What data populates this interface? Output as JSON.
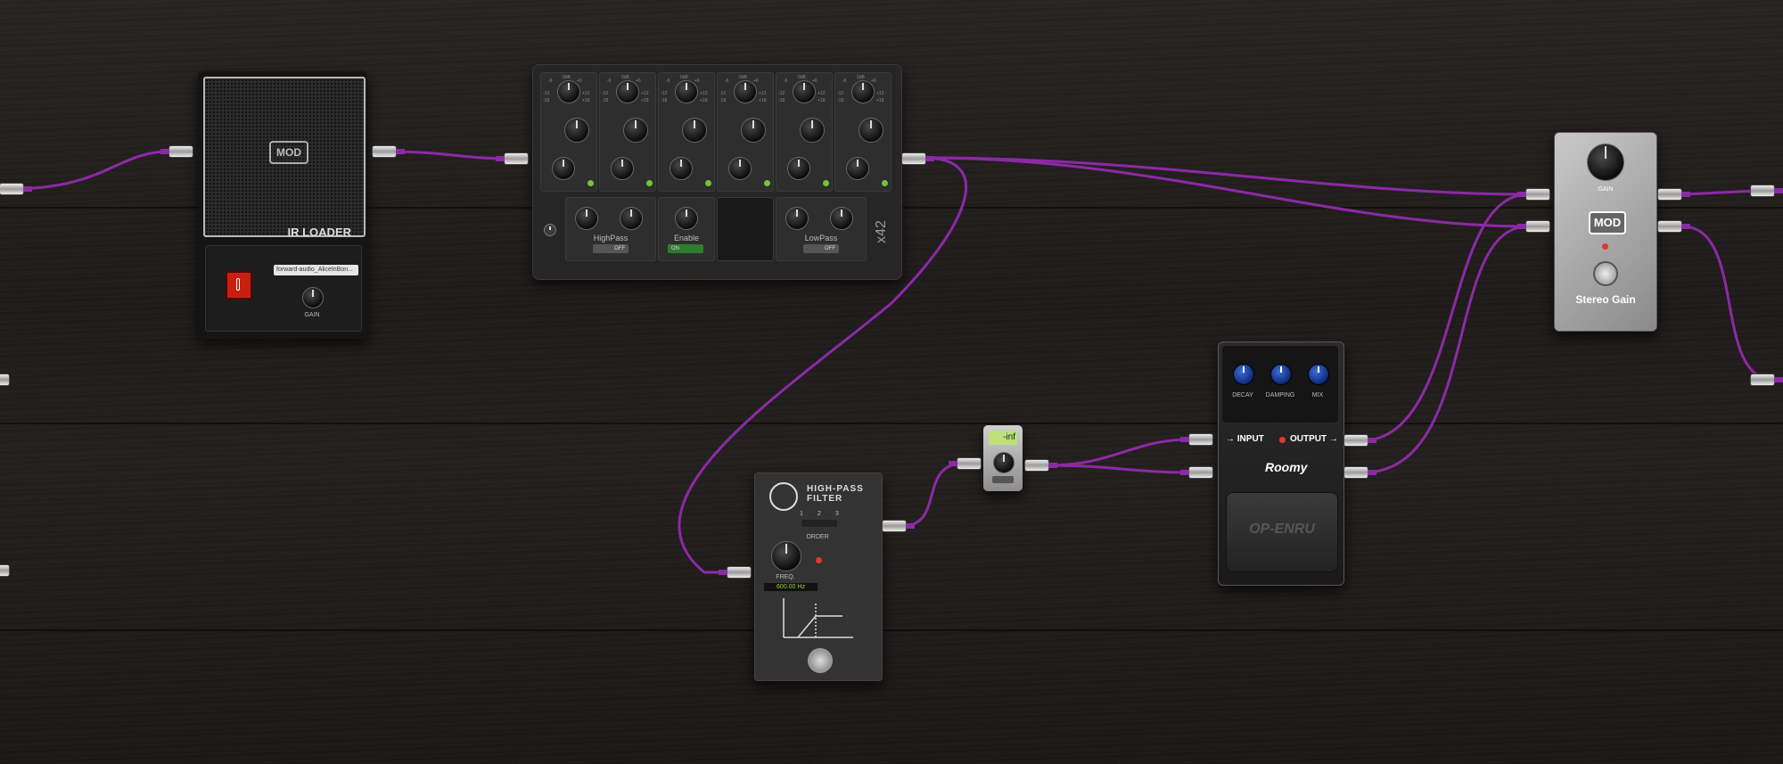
{
  "colors": {
    "cable": "#8c2aa6",
    "wood": "#231f1e",
    "eq_led": "#74c33a",
    "roomy_knob": "#2f63d0"
  },
  "ir_loader": {
    "logo": "MOD",
    "title": "IR LOADER",
    "filename": "forward-audio_AliceInBon...",
    "gain_label": "GAIN"
  },
  "eq": {
    "brand": "x42",
    "highpass_label": "HighPass",
    "highpass_state": "OFF",
    "enable_label": "Enable",
    "enable_state": "ON",
    "lowpass_label": "LowPass",
    "lowpass_state": "OFF",
    "band_scale_top": [
      "-6",
      "0dB",
      "+6"
    ],
    "band_scale_sides": [
      "-12",
      "+12",
      "-18",
      "+18"
    ]
  },
  "hpf": {
    "title_line1": "HIGH-PASS",
    "title_line2": "FILTER",
    "order_options": [
      "1",
      "2",
      "3"
    ],
    "order_label": "ORDER",
    "freq_label": "FREQ.",
    "freq_value": "600.00 Hz"
  },
  "meter": {
    "value": "-inf"
  },
  "roomy": {
    "knobs": [
      "DECAY",
      "DAMPING",
      "MIX"
    ],
    "input_label": "INPUT",
    "output_label": "OUTPUT",
    "brand": "Roomy",
    "stomp_text": "OP-ENRU"
  },
  "stereo_gain": {
    "gain_label": "GAIN",
    "logo": "MOD",
    "title": "Stereo Gain"
  }
}
